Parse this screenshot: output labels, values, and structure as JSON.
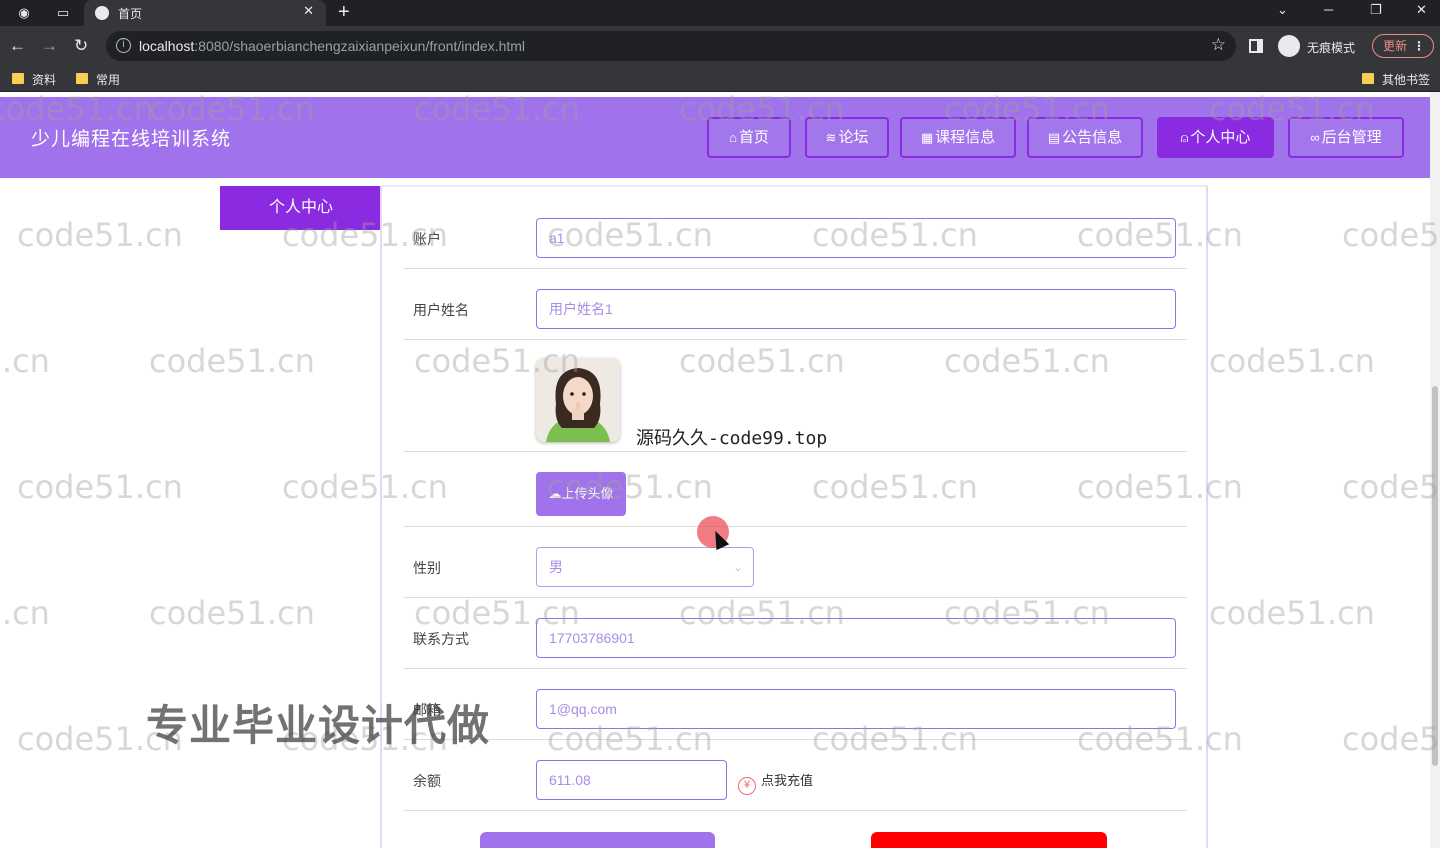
{
  "browser": {
    "tab_title": "首页",
    "url_host": "localhost",
    "url_rest": ":8080/shaoerbianchengzaixianpeixun/front/index.html",
    "incognito_label": "无痕模式",
    "update_label": "更新",
    "bookmarks": [
      "资料",
      "常用"
    ],
    "other_bookmarks": "其他书签"
  },
  "site": {
    "title": "少儿编程在线培训系统",
    "nav": [
      {
        "label": "首页",
        "icon": "home-icon"
      },
      {
        "label": "论坛",
        "icon": "layers-icon"
      },
      {
        "label": "课程信息",
        "icon": "grid-icon"
      },
      {
        "label": "公告信息",
        "icon": "notice-icon"
      },
      {
        "label": "个人中心",
        "icon": "user-icon",
        "active": true
      },
      {
        "label": "后台管理",
        "icon": "link-icon"
      }
    ]
  },
  "sidebar": {
    "tab_label": "个人中心"
  },
  "form": {
    "account": {
      "label": "账户",
      "value": "a1"
    },
    "name": {
      "label": "用户姓名",
      "value": "用户姓名1"
    },
    "avatar_caption": "源码久久-code99.top",
    "upload_label": "上传头像",
    "gender": {
      "label": "性别",
      "value": "男"
    },
    "phone": {
      "label": "联系方式",
      "value": "17703786901"
    },
    "email": {
      "label": "邮箱",
      "value": "1@qq.com"
    },
    "balance": {
      "label": "余额",
      "value": "611.08",
      "recharge_label": "点我充值"
    }
  },
  "overlays": {
    "watermark": "code51.cn",
    "promo": "专业毕业设计代做"
  },
  "colors": {
    "header_bg": "#a072ec",
    "accent": "#8a2be2",
    "danger": "#ff0000"
  }
}
